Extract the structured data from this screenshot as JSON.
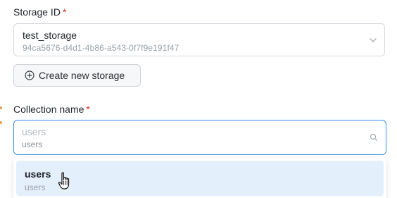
{
  "storage": {
    "label": "Storage ID",
    "required_mark": "*",
    "selected_name": "test_storage",
    "selected_id": "94ca5676-d4d1-4b86-a543-0f7f9e191f47",
    "chevron_icon": "chevron-down-icon"
  },
  "create_storage": {
    "label": "Create new storage",
    "icon": "plus-circle-icon"
  },
  "collection": {
    "label": "Collection name",
    "required_mark": "*",
    "input_value": "users",
    "input_sub": "users",
    "search_icon": "search-icon"
  },
  "dropdown": {
    "options": [
      {
        "title": "users",
        "subtitle": "users"
      }
    ]
  },
  "colors": {
    "focus_border": "#3a8ee6",
    "required": "#d92d20",
    "highlight": "#e3effb",
    "left_marker": "#f29b4b"
  }
}
